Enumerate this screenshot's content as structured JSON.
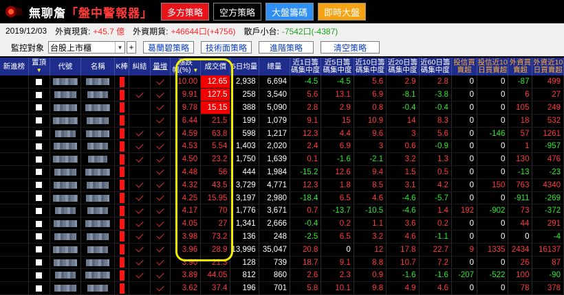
{
  "app": {
    "title_a": "無聊詹",
    "title_b": "「盤中警報器」"
  },
  "nav": [
    {
      "label": "多方策略",
      "bg": "#e8141a",
      "color": "#ffffff"
    },
    {
      "label": "空方策略",
      "bg": "#000000",
      "color": "#ffffff"
    },
    {
      "label": "大盤籌碼",
      "bg": "#2f8ff2",
      "color": "#ffffff"
    },
    {
      "label": "即時大盤",
      "bg": "#f6a313",
      "color": "#ffffff"
    }
  ],
  "info": {
    "date": "2019/12/03",
    "spot_label": "外資現貨:",
    "spot_value": "+45.7 億",
    "futures_label": "外資期貨:",
    "futures_value": "+46644口(+4756)",
    "retail_label": "散戶小台:",
    "retail_value": "-7542口(-4387)"
  },
  "toolbar": {
    "monitor_label": "監控對象",
    "monitor_value": "台股上市櫃",
    "plus": "+",
    "strategies": [
      "葛蘭碧策略",
      "技術面策略",
      "進階策略",
      "清空策略"
    ]
  },
  "columns": {
    "new": "新進榜",
    "pin": "置頂",
    "code": "代號",
    "name": "名稱",
    "k": "K棒",
    "tangle": "糾結",
    "vol_up": "量增",
    "chg_a": "漲跌",
    "chg_b": "幅(%)",
    "price": "成交價",
    "ma5": "5日均量",
    "vol": "總量",
    "c1a": "近1日籌",
    "c1b": "碼集中度",
    "c5a": "近5日籌",
    "c5b": "碼集中度",
    "c10a": "近10日籌",
    "c10b": "碼集中度",
    "c20a": "近20日籌",
    "c20b": "碼集中度",
    "c60a": "近60日籌",
    "c60b": "碼集中度",
    "itb_a": "投信買",
    "itb_b": "賣超",
    "it10_a": "投信近10",
    "it10_b": "日買賣超",
    "fb_a": "外資買",
    "fb_b": "賣超",
    "f10_a": "外資近10",
    "f10_b": "日買賣超"
  },
  "rows": [
    {
      "tangle": false,
      "volup": true,
      "chg": "10.00",
      "price": "12.65",
      "hi": true,
      "ma5": "2,938",
      "vol": "6,694",
      "c1": "-4.5",
      "c5": "-4.5",
      "c10": "5.6",
      "c20": "2.9",
      "c60": "2.8",
      "itb": "0",
      "it10": "0",
      "fb": "-87",
      "f10": "499"
    },
    {
      "tangle": true,
      "volup": true,
      "chg": "9.91",
      "price": "127.5",
      "hi": true,
      "ma5": "258",
      "vol": "3,540",
      "c1": "5.6",
      "c5": "13.1",
      "c10": "6.9",
      "c20": "-8.1",
      "c60": "-3.8",
      "itb": "0",
      "it10": "0",
      "fb": "6",
      "f10": "27"
    },
    {
      "tangle": false,
      "volup": true,
      "chg": "9.78",
      "price": "15.15",
      "hi": true,
      "ma5": "388",
      "vol": "5,090",
      "c1": "2.8",
      "c5": "2.9",
      "c10": "0.8",
      "c20": "-0.4",
      "c60": "-0.4",
      "itb": "0",
      "it10": "0",
      "fb": "105",
      "f10": "249"
    },
    {
      "tangle": false,
      "volup": true,
      "chg": "6.44",
      "price": "21.5",
      "hi": false,
      "ma5": "199",
      "vol": "1,079",
      "c1": "9.1",
      "c5": "15",
      "c10": "10.9",
      "c20": "14",
      "c60": "8.3",
      "itb": "0",
      "it10": "0",
      "fb": "18",
      "f10": "532"
    },
    {
      "tangle": true,
      "volup": true,
      "chg": "4.59",
      "price": "63.8",
      "hi": false,
      "ma5": "598",
      "vol": "1,217",
      "c1": "12.3",
      "c5": "4.4",
      "c10": "9.6",
      "c20": "3",
      "c60": "5.6",
      "itb": "0",
      "it10": "-146",
      "fb": "57",
      "f10": "1261"
    },
    {
      "tangle": true,
      "volup": true,
      "chg": "4.53",
      "price": "5.54",
      "hi": false,
      "ma5": "1,403",
      "vol": "2,020",
      "c1": "2.4",
      "c5": "6.9",
      "c10": "3",
      "c20": "0.6",
      "c60": "-0.9",
      "itb": "0",
      "it10": "0",
      "fb": "1",
      "f10": "-957"
    },
    {
      "tangle": true,
      "volup": true,
      "chg": "4.50",
      "price": "23.2",
      "hi": false,
      "ma5": "1,750",
      "vol": "1,639",
      "c1": "0.1",
      "c5": "-1.6",
      "c10": "-2.1",
      "c20": "3.2",
      "c60": "1.3",
      "itb": "0",
      "it10": "0",
      "fb": "130",
      "f10": "476"
    },
    {
      "tangle": false,
      "volup": true,
      "chg": "4.48",
      "price": "56",
      "hi": false,
      "ma5": "444",
      "vol": "1,984",
      "c1": "-15.2",
      "c5": "12.6",
      "c10": "9.4",
      "c20": "1.5",
      "c60": "0.5",
      "itb": "0",
      "it10": "0",
      "fb": "-13",
      "f10": "-23"
    },
    {
      "tangle": true,
      "volup": true,
      "chg": "4.32",
      "price": "43.5",
      "hi": false,
      "ma5": "3,729",
      "vol": "4,771",
      "c1": "12.3",
      "c5": "1.8",
      "c10": "8.5",
      "c20": "3.1",
      "c60": "4.2",
      "itb": "0",
      "it10": "150",
      "fb": "763",
      "f10": "4340"
    },
    {
      "tangle": true,
      "volup": true,
      "chg": "4.25",
      "price": "15.95",
      "hi": false,
      "ma5": "3,197",
      "vol": "2,980",
      "c1": "-18.4",
      "c5": "6.5",
      "c10": "4.6",
      "c20": "-4.6",
      "c60": "-5.7",
      "itb": "0",
      "it10": "0",
      "fb": "-911",
      "f10": "-269"
    },
    {
      "tangle": true,
      "volup": true,
      "chg": "4.17",
      "price": "70",
      "hi": false,
      "ma5": "1,776",
      "vol": "3,671",
      "c1": "0.7",
      "c5": "-13.7",
      "c10": "-10.5",
      "c20": "-4.6",
      "c60": "1.4",
      "itb": "192",
      "it10": "-902",
      "fb": "73",
      "f10": "-372"
    },
    {
      "tangle": true,
      "volup": true,
      "chg": "4.05",
      "price": "27",
      "hi": false,
      "ma5": "1,341",
      "vol": "2,666",
      "c1": "-0.4",
      "c5": "0.2",
      "c10": "1.1",
      "c20": "3.6",
      "c60": "0.2",
      "itb": "0",
      "it10": "0",
      "fb": "44",
      "f10": "291"
    },
    {
      "tangle": true,
      "volup": true,
      "chg": "3.98",
      "price": "73.2",
      "hi": false,
      "ma5": "136",
      "vol": "248",
      "c1": "-2.5",
      "c5": "6.5",
      "c10": "3.2",
      "c20": "4.6",
      "c60": "-1.1",
      "itb": "0",
      "it10": "0",
      "fb": "0",
      "f10": "-4"
    },
    {
      "tangle": true,
      "volup": true,
      "chg": "3.96",
      "price": "28.9",
      "hi": false,
      "ma5": "13,996",
      "vol": "35,047",
      "c1": "20.8",
      "c5": "0",
      "c10": "12",
      "c20": "17.8",
      "c60": "22.7",
      "itb": "9",
      "it10": "1335",
      "fb": "2434",
      "f10": "16137"
    },
    {
      "tangle": true,
      "volup": true,
      "chg": "3.90",
      "price": "21.3",
      "hi": false,
      "ma5": "128",
      "vol": "739",
      "c1": "18.7",
      "c5": "9.1",
      "c10": "8.8",
      "c20": "10.7",
      "c60": "7.2",
      "itb": "0",
      "it10": "0",
      "fb": "26",
      "f10": "87"
    },
    {
      "tangle": true,
      "volup": true,
      "chg": "3.89",
      "price": "44.05",
      "hi": false,
      "ma5": "812",
      "vol": "860",
      "c1": "2.6",
      "c5": "2.3",
      "c10": "0.9",
      "c20": "-1.6",
      "c60": "-1.6",
      "itb": "-207",
      "it10": "-522",
      "fb": "100",
      "f10": "-90"
    },
    {
      "tangle": false,
      "volup": true,
      "chg": "3.62",
      "price": "37.4",
      "hi": false,
      "ma5": "196",
      "vol": "701",
      "c1": "5.8",
      "c5": "10.1",
      "c10": "9.8",
      "c20": "4.9",
      "c60": "4.6",
      "itb": "0",
      "it10": "0",
      "fb": "78",
      "f10": "378"
    }
  ]
}
